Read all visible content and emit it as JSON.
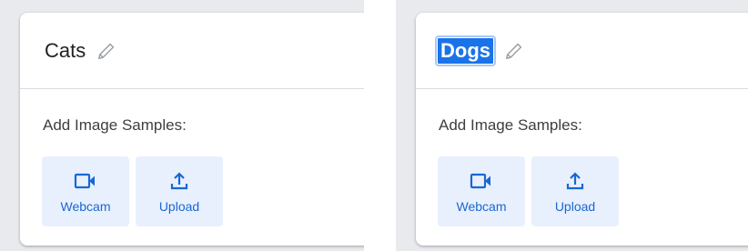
{
  "left_card": {
    "title": "Cats",
    "section_label": "Add Image Samples:",
    "webcam_label": "Webcam",
    "upload_label": "Upload"
  },
  "right_card": {
    "title": "Dogs",
    "section_label": "Add Image Samples:",
    "webcam_label": "Webcam",
    "upload_label": "Upload"
  },
  "colors": {
    "accent": "#1967d2",
    "button_bg": "#e8f0fe",
    "selection": "#1a73e8",
    "page_bg": "#e8eaed"
  },
  "icons": [
    "pencil-icon",
    "webcam-icon",
    "upload-icon"
  ]
}
